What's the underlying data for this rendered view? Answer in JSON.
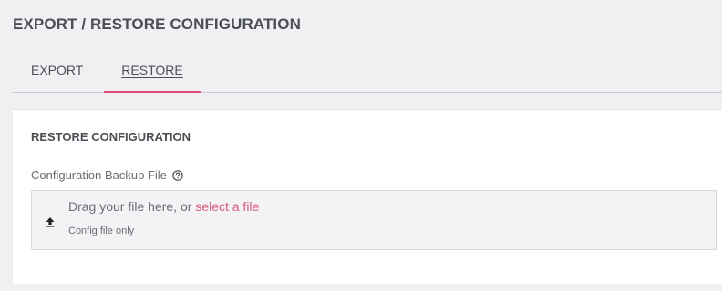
{
  "page": {
    "title": "EXPORT / RESTORE CONFIGURATION"
  },
  "tabs": [
    {
      "label": "EXPORT",
      "active": false
    },
    {
      "label": "RESTORE",
      "active": true
    }
  ],
  "accent_color": "#e0477a",
  "restore": {
    "section_title": "RESTORE CONFIGURATION",
    "field_label": "Configuration Backup File",
    "help_icon": "question-circle-icon",
    "dropzone": {
      "icon": "upload-icon",
      "text": "Drag your file here, or",
      "link_text": "select a file",
      "hint": "Config file only"
    }
  }
}
